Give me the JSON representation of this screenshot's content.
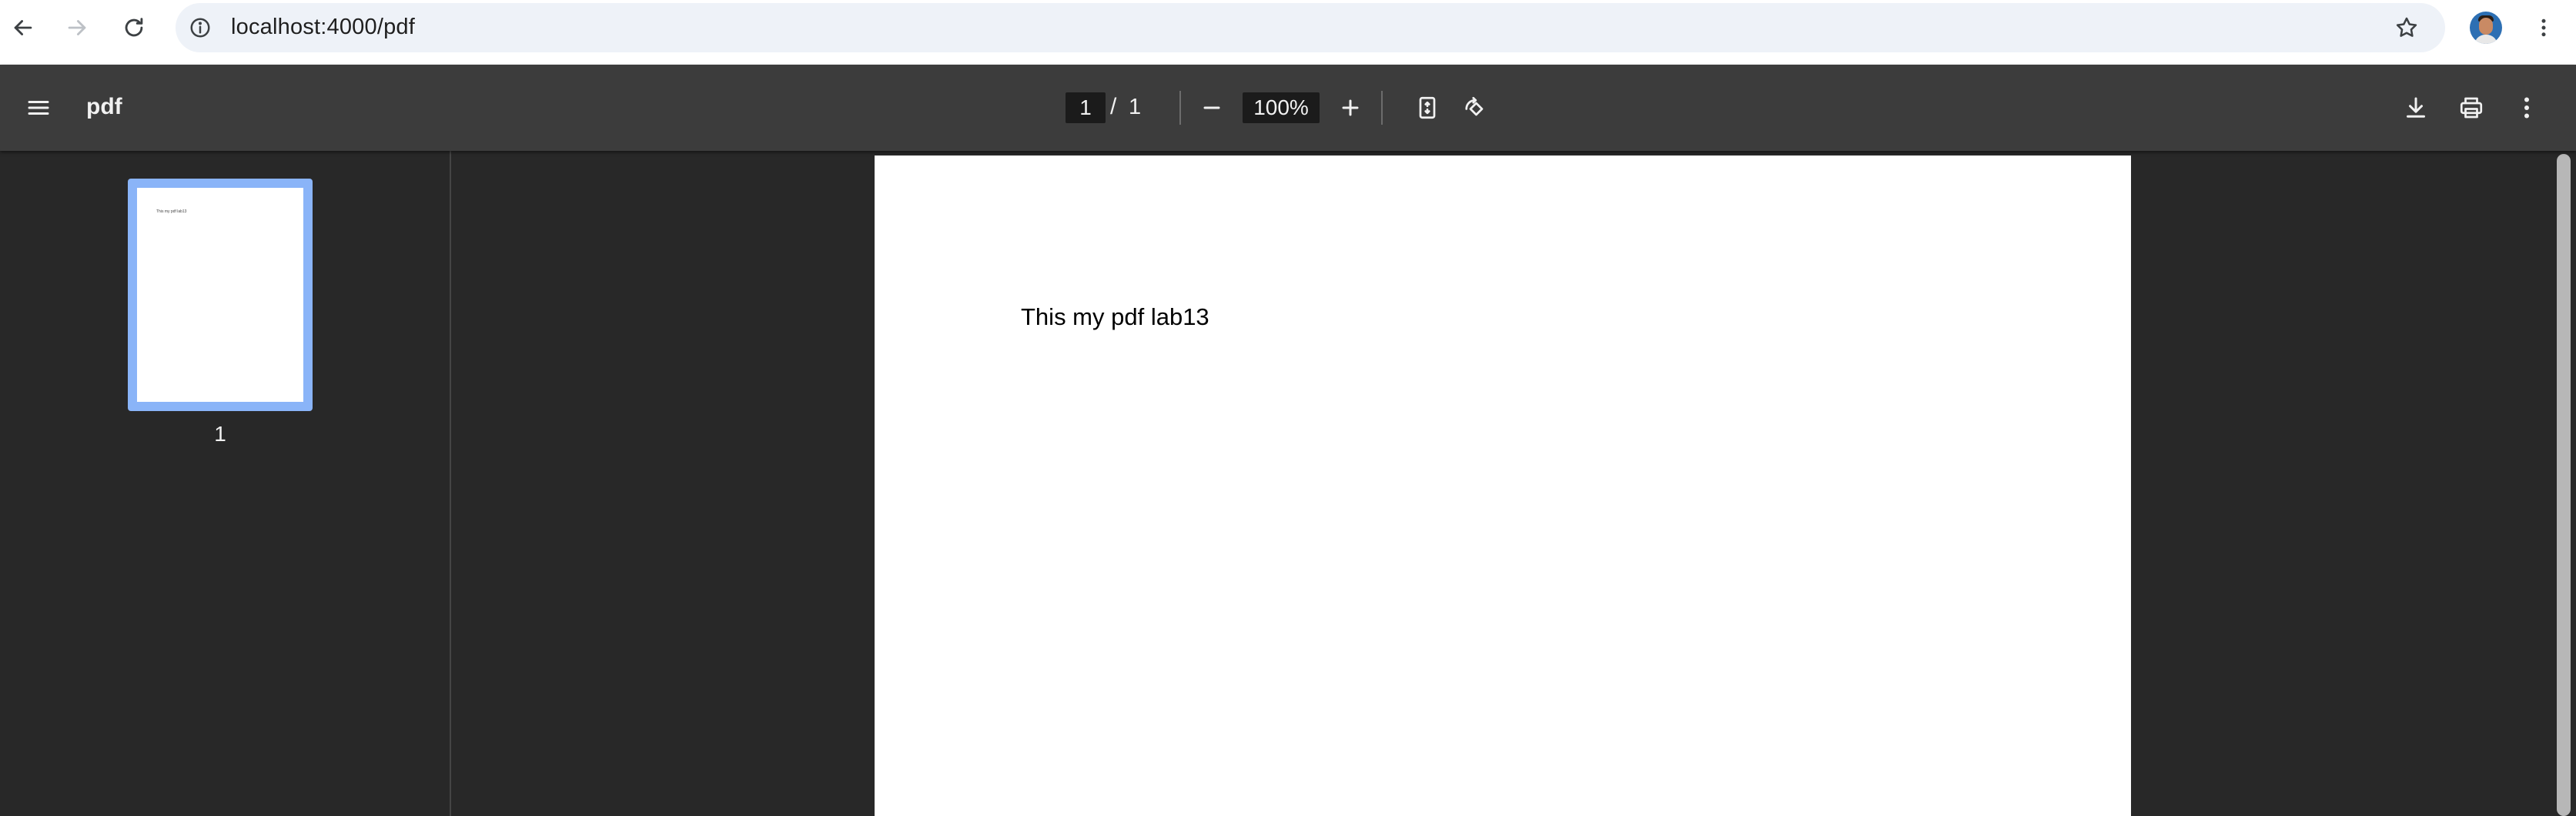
{
  "browser": {
    "url": "localhost:4000/pdf",
    "icons": {
      "back": "arrow-left-icon",
      "forward": "arrow-right-icon",
      "reload": "reload-icon",
      "site_info": "info-icon",
      "bookmark": "star-icon",
      "menu": "vertical-dots-icon"
    }
  },
  "viewer": {
    "title": "pdf",
    "current_page": "1",
    "page_separator": "/",
    "total_pages": "1",
    "zoom": "100%",
    "icons": {
      "menu": "hamburger-icon",
      "zoom_out": "minus-icon",
      "zoom_in": "plus-icon",
      "fit": "fit-page-icon",
      "rotate": "rotate-icon",
      "download": "download-icon",
      "print": "print-icon",
      "more": "vertical-dots-icon"
    }
  },
  "sidebar": {
    "thumbnails": [
      {
        "label": "1"
      }
    ]
  },
  "document": {
    "text": "This my pdf lab13"
  },
  "colors": {
    "toolbar": "#3c3c3c",
    "background": "#282828",
    "thumbnail_selected": "#8ab4f8",
    "omnibox": "#eef2f8"
  }
}
